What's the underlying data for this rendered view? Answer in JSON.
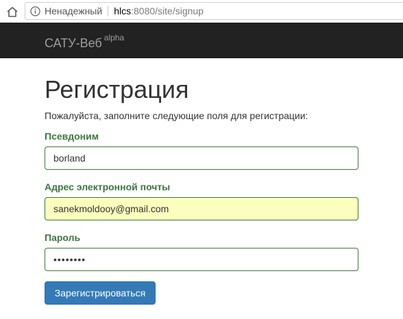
{
  "browser": {
    "security_label": "Ненадежный",
    "url_host": "hlcs",
    "url_rest": ":8080/site/signup"
  },
  "navbar": {
    "brand": "САТУ-Веб",
    "brand_badge": "alpha"
  },
  "page": {
    "title": "Регистрация",
    "lead": "Пожалуйста, заполните следующие поля для регистрации:"
  },
  "form": {
    "username_label": "Псевдоним",
    "username_value": "borland",
    "email_label": "Адрес электронной почты",
    "email_value": "sanekmoldooy@gmail.com",
    "password_label": "Пароль",
    "password_value": "••••••••",
    "submit_label": "Зарегистрироваться"
  },
  "colors": {
    "navbar_bg": "#222222",
    "success_green": "#3c763d",
    "primary_blue": "#337ab7",
    "autofill_yellow": "#faffbd"
  },
  "icons": {
    "home": "home-icon",
    "info": "info-icon"
  }
}
